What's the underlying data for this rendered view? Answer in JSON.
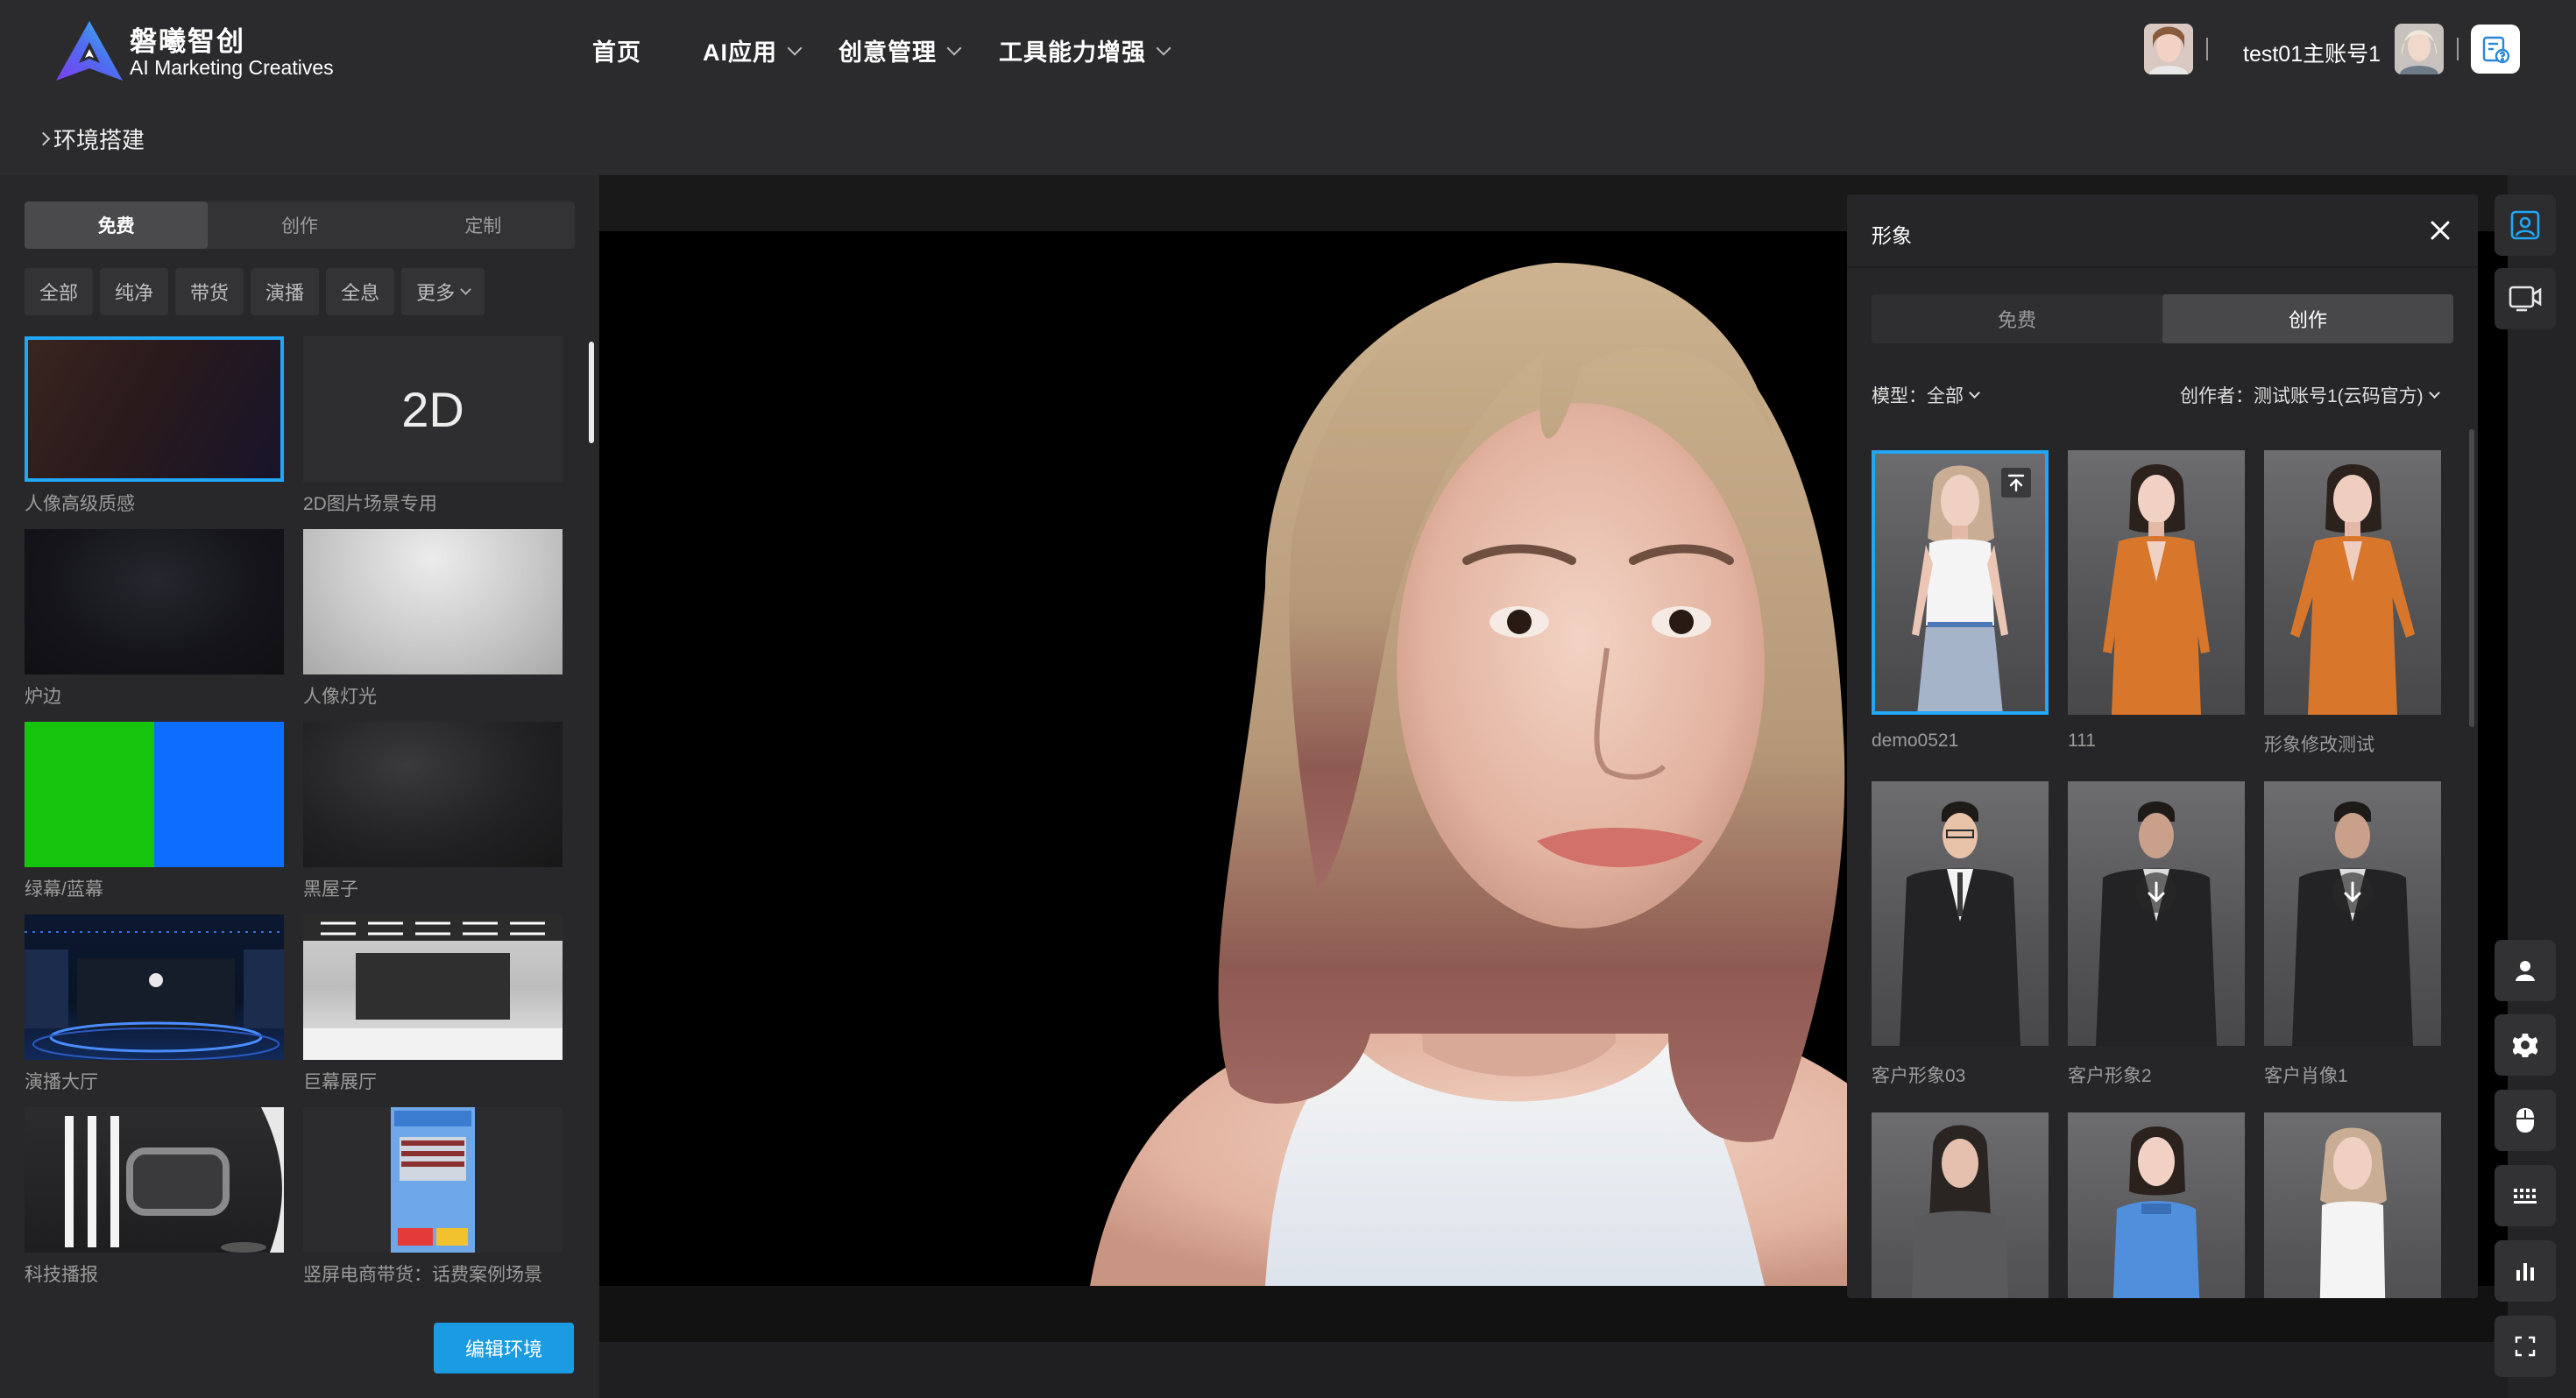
{
  "brand": {
    "name_cn": "磐曦智创",
    "name_en": "AI Marketing Creatives"
  },
  "nav": [
    {
      "label": "首页",
      "has_dropdown": false
    },
    {
      "label": "AI应用",
      "has_dropdown": true
    },
    {
      "label": "创意管理",
      "has_dropdown": true
    },
    {
      "label": "工具能力增强",
      "has_dropdown": true
    }
  ],
  "user": {
    "name": "test01主账号1",
    "help_icon": "help-doc-icon"
  },
  "breadcrumb": {
    "label": "环境搭建"
  },
  "left_panel": {
    "tabs": [
      {
        "label": "免费",
        "active": true
      },
      {
        "label": "创作",
        "active": false
      },
      {
        "label": "定制",
        "active": false
      }
    ],
    "filters": [
      "全部",
      "纯净",
      "带货",
      "演播",
      "全息"
    ],
    "filter_more": "更多",
    "environments": [
      {
        "label": "人像高级质感",
        "selected": true
      },
      {
        "label": "2D图片场景专用",
        "thumb_text": "2D"
      },
      {
        "label": "炉边"
      },
      {
        "label": "人像灯光"
      },
      {
        "label": "绿幕/蓝幕"
      },
      {
        "label": "黑屋子"
      },
      {
        "label": "演播大厅"
      },
      {
        "label": "巨幕展厅"
      },
      {
        "label": "科技播报"
      },
      {
        "label": "竖屏电商带货：话费案例场景"
      }
    ],
    "edit_button": "编辑环境"
  },
  "figure_panel": {
    "title": "形象",
    "tabs": [
      {
        "label": "免费",
        "active": false
      },
      {
        "label": "创作",
        "active": true
      }
    ],
    "model_filter": {
      "label": "模型：",
      "value": "全部"
    },
    "creator_filter": {
      "label": "创作者：",
      "value": "测试账号1(云码官方)"
    },
    "figures": [
      {
        "label": "demo0521",
        "selected": true,
        "badge": "pin-top-icon"
      },
      {
        "label": "111"
      },
      {
        "label": "形象修改测试"
      },
      {
        "label": "客户形象03"
      },
      {
        "label": "客户形象2",
        "badge": "download-icon"
      },
      {
        "label": "客户肖像1",
        "badge": "download-icon"
      },
      {
        "label": "",
        "badge": "download-icon"
      },
      {
        "label": ""
      },
      {
        "label": ""
      }
    ]
  },
  "right_toolbar": [
    "figure-panel-icon",
    "screen-panel-icon",
    "person-icon",
    "settings-chip-icon",
    "mouse-icon",
    "keyboard-icon",
    "bar-chart-icon",
    "fullscreen-icon"
  ],
  "colors": {
    "accent": "#1a9be2",
    "selection": "#21a7f5",
    "page_bg": "#1f1f21",
    "topbar_bg": "#2b2b2d"
  }
}
